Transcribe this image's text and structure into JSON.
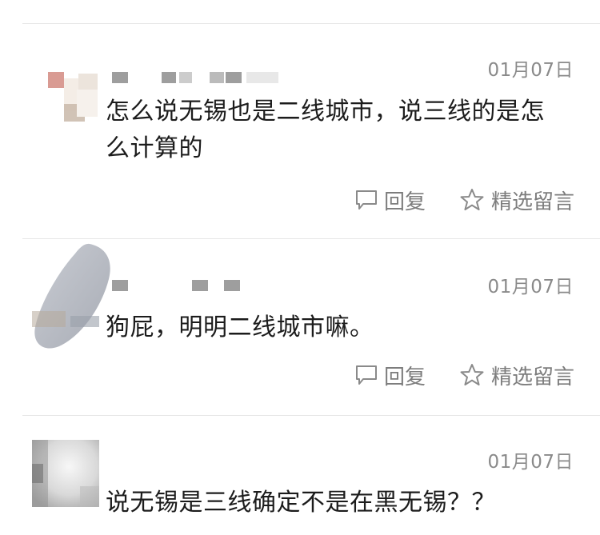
{
  "comments": [
    {
      "date": "01月07日",
      "text": "怎么说无锡也是二线城市，说三线的是怎么计算的",
      "reply_label": "回复",
      "feature_label": "精选留言",
      "avatar_icon": "blurred-avatar"
    },
    {
      "date": "01月07日",
      "text": "狗屁，明明二线城市嘛。",
      "reply_label": "回复",
      "feature_label": "精选留言",
      "avatar_icon": "blurred-avatar"
    },
    {
      "date": "01月07日",
      "text": "说无锡是三线确定不是在黑无锡？？",
      "avatar_icon": "blurred-avatar"
    }
  ],
  "icons": {
    "reply": "comment-bubble-icon",
    "feature": "star-outline-icon"
  },
  "colors": {
    "text": "#1c1c1c",
    "meta": "#8a8a8a",
    "divider": "#e6e6e6"
  }
}
